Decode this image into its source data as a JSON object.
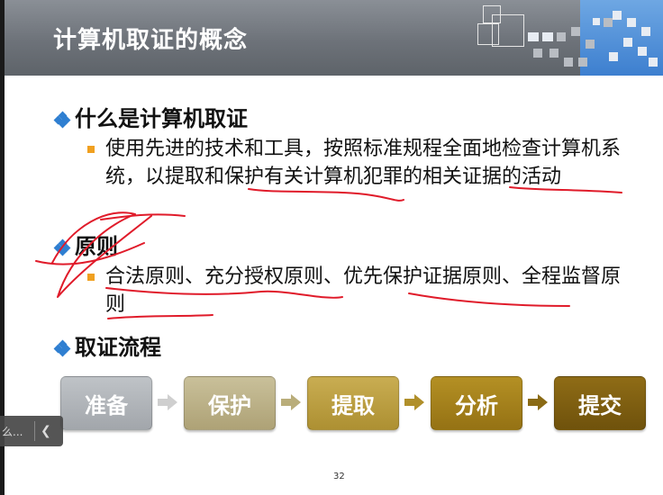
{
  "slide": {
    "title": "计算机取证的概念",
    "sections": [
      {
        "heading": "什么是计算机取证",
        "sub": [
          "使用先进的技术和工具，按照标准规程全面地检查计算机系统，以提取和保护有关计算机犯罪的相关证据的活动"
        ]
      },
      {
        "heading": "原则",
        "sub": [
          "合法原则、充分授权原则、优先保护证据原则、全程监督原则"
        ]
      },
      {
        "heading": "取证流程",
        "sub": []
      }
    ],
    "flow_steps": [
      "准备",
      "保护",
      "提取",
      "分析",
      "提交"
    ],
    "page_number": "32"
  },
  "overlay": {
    "truncated_label": "么...",
    "collapse_icon": "chevron-left-icon"
  },
  "colors": {
    "title_bar": "#6d7279",
    "accent_blue": "#3d7fcf",
    "bullet_orange": "#f0a020",
    "ink_red": "#e01b2a",
    "flow": [
      "#a9adb2",
      "#b7ad80",
      "#b59a3e",
      "#9e7d1f",
      "#7a5c10"
    ]
  }
}
